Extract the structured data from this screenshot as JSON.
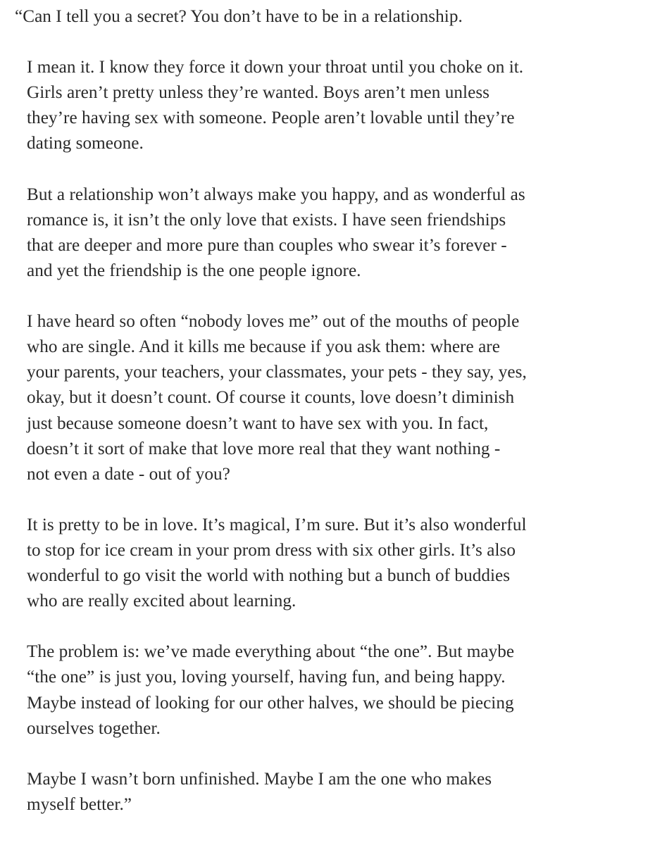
{
  "document": {
    "paragraphs": [
      {
        "lines": [
          "“Can I tell you a secret? You don’t have to be in a relationship."
        ]
      },
      {
        "lines": [
          "I mean it. I know they force it down your throat until you choke on it.",
          "Girls aren’t pretty unless they’re wanted. Boys aren’t men unless",
          "they’re having sex with someone. People aren’t lovable until they’re",
          "dating someone."
        ]
      },
      {
        "lines": [
          "But a relationship won’t always make you happy, and as wonderful as",
          "romance is, it isn’t the only love that exists. I have seen friendships",
          "that are deeper and more pure than couples who swear it’s forever -",
          "and yet the friendship is the one people ignore."
        ]
      },
      {
        "lines": [
          "I have heard so often “nobody loves me” out of the mouths of people",
          "who are single. And it kills me because if you ask them: where are",
          "your parents, your teachers, your classmates, your pets - they say, yes,",
          "okay, but it doesn’t count. Of course it counts, love doesn’t diminish",
          "just because someone doesn’t want to have sex with you. In fact,",
          "doesn’t it sort of make that love more real that they want nothing -",
          "not even a date - out of you?"
        ]
      },
      {
        "lines": [
          "It is pretty to be in love. It’s magical, I’m sure. But it’s also wonderful",
          "to stop for ice cream in your prom dress with six other girls. It’s also",
          "wonderful to go visit the world with nothing but a bunch of buddies",
          "who are really excited about learning."
        ]
      },
      {
        "lines": [
          "The problem is: we’ve made everything about “the one”. But maybe",
          "“the one” is just you, loving yourself, having fun, and being happy.",
          "Maybe instead of looking for our other halves, we should be piecing",
          "ourselves together."
        ]
      },
      {
        "lines": [
          "Maybe I wasn’t born unfinished. Maybe I am the one who makes",
          "myself better.”"
        ]
      }
    ]
  }
}
